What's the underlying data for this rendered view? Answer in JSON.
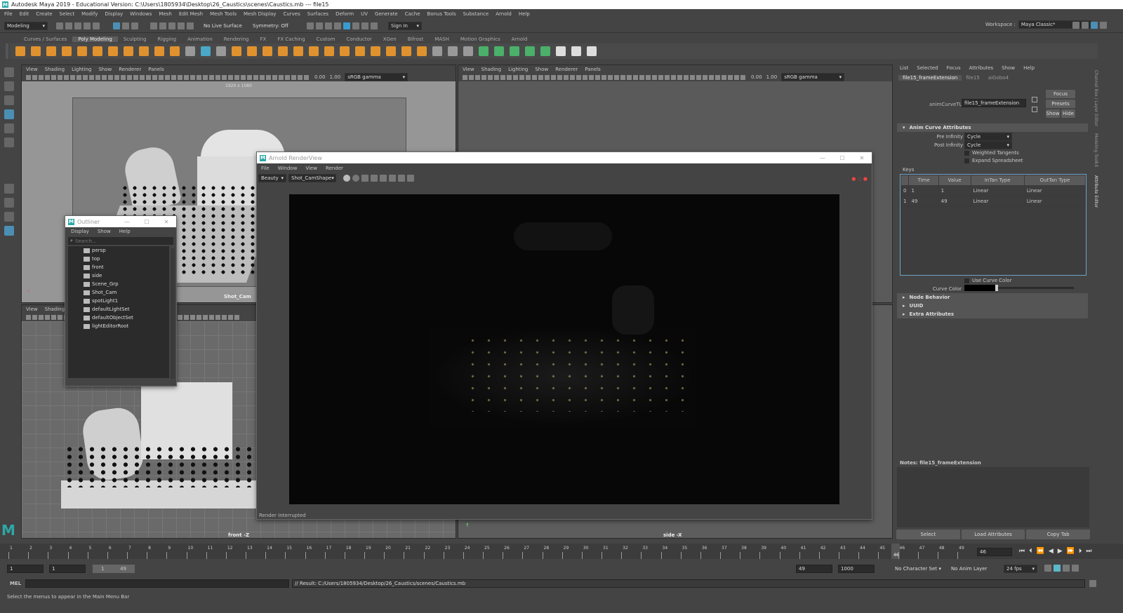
{
  "window_title": "Autodesk Maya 2019 - Educational Version: C:\\Users\\1805934\\Desktop\\26_Caustics\\scenes\\Caustics.mb   ---   file15",
  "main_menu": [
    "File",
    "Edit",
    "Create",
    "Select",
    "Modify",
    "Display",
    "Windows",
    "Mesh",
    "Edit Mesh",
    "Mesh Tools",
    "Mesh Display",
    "Curves",
    "Surfaces",
    "Deform",
    "UV",
    "Generate",
    "Cache",
    "Bonus Tools",
    "Substance",
    "Arnold",
    "Help"
  ],
  "workspace": {
    "label": "Workspace :",
    "value": "Maya Classic*"
  },
  "status": {
    "menuset": "Modeling",
    "live_surface": "No Live Surface",
    "symmetry": "Symmetry: Off",
    "sign_in": "Sign In"
  },
  "shelf_tabs": [
    "Curves / Surfaces",
    "Poly Modeling",
    "Sculpting",
    "Rigging",
    "Animation",
    "Rendering",
    "FX",
    "FX Caching",
    "Custom",
    "Conductor",
    "XGen",
    "Bifrost",
    "MASH",
    "Motion Graphics",
    "Arnold"
  ],
  "shelf_active": "Poly Modeling",
  "viewport_menu": [
    "View",
    "Shading",
    "Lighting",
    "Show",
    "Renderer",
    "Panels"
  ],
  "viewport_small_menu": [
    "View",
    "Shading"
  ],
  "viewport": {
    "values": [
      "0.00",
      "1.00"
    ],
    "color_space": "sRGB gamma",
    "resolution": "1920 x 1080",
    "cam_top": "Shot_Cam",
    "cam_bl": "front -Z",
    "cam_br": "side -X"
  },
  "outliner": {
    "title": "Outliner",
    "menu": [
      "Display",
      "Show",
      "Help"
    ],
    "search_placeholder": "Search...",
    "items": [
      "persp",
      "top",
      "front",
      "side",
      "Scene_Grp",
      "Shot_Cam",
      "spotLight1",
      "defaultLightSet",
      "defaultObjectSet",
      "lightEditorRoot"
    ]
  },
  "render_view": {
    "title": "Arnold RenderView",
    "menu": [
      "File",
      "Window",
      "View",
      "Render"
    ],
    "aov": "Beauty",
    "camera": "Shot_CamShape",
    "status": "Render Interrupted"
  },
  "attr_editor": {
    "menu": [
      "List",
      "Selected",
      "Focus",
      "Attributes",
      "Show",
      "Help"
    ],
    "tabs": [
      "file15_frameExtension",
      "file15",
      "aiGobo4"
    ],
    "node_label": "animCurveTU:",
    "node_value": "file15_frameExtension",
    "buttons": {
      "focus": "Focus",
      "presets": "Presets",
      "show": "Show",
      "hide": "Hide"
    },
    "section_curve": "Anim Curve Attributes",
    "pre_infinity_label": "Pre Infinity",
    "pre_infinity": "Cycle",
    "post_infinity_label": "Post Infinity",
    "post_infinity": "Cycle",
    "weighted": "Weighted Tangents",
    "expand": "Expand Spreadsheet",
    "keys_label": "Keys",
    "key_headers": [
      "Time",
      "Value",
      "InTan Type",
      "OutTan Type"
    ],
    "keys": [
      {
        "idx": "0",
        "time": "1",
        "value": "1",
        "in": "Linear",
        "out": "Linear"
      },
      {
        "idx": "1",
        "time": "49",
        "value": "49",
        "in": "Linear",
        "out": "Linear"
      }
    ],
    "use_curve_color": "Use Curve Color",
    "curve_color": "Curve Color",
    "sections": [
      "Node Behavior",
      "UUID",
      "Extra Attributes"
    ],
    "notes": "Notes:  file15_frameExtension",
    "bottom_buttons": [
      "Select",
      "Load Attributes",
      "Copy Tab"
    ],
    "side_tabs": [
      "Channel Box / Layer Editor",
      "Modeling Toolkit",
      "Attribute Editor"
    ]
  },
  "timeline": {
    "ticks": [
      "1",
      "2",
      "3",
      "4",
      "5",
      "6",
      "7",
      "8",
      "9",
      "10",
      "11",
      "12",
      "13",
      "14",
      "15",
      "16",
      "17",
      "18",
      "19",
      "20",
      "21",
      "22",
      "23",
      "24",
      "25",
      "26",
      "27",
      "28",
      "29",
      "30",
      "31",
      "32",
      "33",
      "34",
      "35",
      "36",
      "37",
      "38",
      "39",
      "40",
      "41",
      "42",
      "43",
      "44",
      "45",
      "46",
      "47",
      "48",
      "49"
    ],
    "current": "46",
    "current_field": "46"
  },
  "range": {
    "start": "1",
    "start2": "1",
    "slider_start": "1",
    "slider_end": "49",
    "end": "49",
    "end2": "1000",
    "char_set": "No Character Set",
    "anim_layer": "No Anim Layer",
    "fps": "24 fps"
  },
  "command": {
    "lang": "MEL",
    "result": "// Result: C:/Users/1805934/Desktop/26_Caustics/scenes/Caustics.mb"
  },
  "help_line": "Select the menus to appear in the Main Menu Bar"
}
